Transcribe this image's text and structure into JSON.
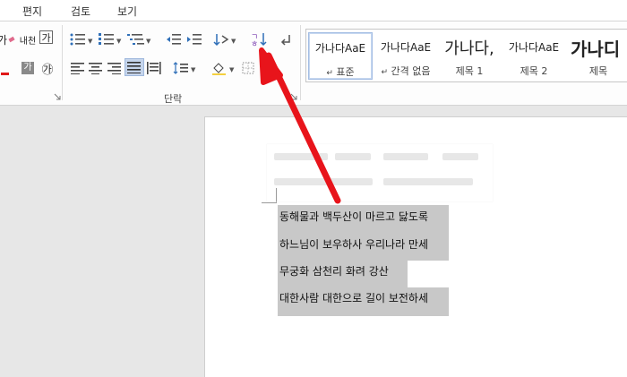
{
  "tabs": [
    "편지",
    "검토",
    "보기"
  ],
  "ribbon": {
    "font_group": {
      "char_border_icon": "가",
      "phonetic_icon": "내천",
      "char_shading_icon": "가",
      "enclosed_icon": "㉮",
      "brush_icon": "가"
    },
    "paragraph_group": {
      "label": "단락"
    },
    "styles": [
      {
        "preview": "가나다AaE",
        "name": "표준",
        "name_icon": "↵",
        "selected": true
      },
      {
        "preview": "가나다AaE",
        "name": "간격 없음",
        "name_icon": "↵",
        "selected": false
      },
      {
        "preview": "가나다,",
        "name": "제목 1",
        "name_icon": "",
        "selected": false
      },
      {
        "preview": "가나다AaE",
        "name": "제목 2",
        "name_icon": "",
        "selected": false
      },
      {
        "preview": "가나디",
        "name": "제목",
        "name_icon": "",
        "selected": false
      }
    ]
  },
  "document": {
    "lines": [
      "동해물과 백두산이 마르고 닳도록",
      "하느님이 보우하사 우리나라 만세",
      "무궁화 삼천리 화려 강산",
      "대한사람 대한으로 길이 보전하세"
    ]
  },
  "annotation": {
    "arrow_color": "#e8141b",
    "target": "sort-button"
  },
  "colors": {
    "accent_selected": "#c5d5ec",
    "highlight": "#c8c8c8"
  }
}
